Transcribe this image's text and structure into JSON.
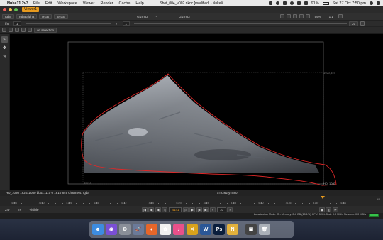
{
  "menubar": {
    "app": "Nuke11.2v3",
    "items": [
      "File",
      "Edit",
      "Workspace",
      "Viewer",
      "Render",
      "Cache",
      "Help"
    ],
    "window_title": "Shot_004_v002.nknc [modified] - NukeX",
    "battery": "91%",
    "clock": "Sat 27 Oct  7:50 pm"
  },
  "viewer_tab": {
    "label": "Viewer1"
  },
  "toolbar1": {
    "channels": "rgba",
    "alpha": "rgba.alpha",
    "display": "RGB",
    "colorspace": "sRGB",
    "input_a": "Gizmo3",
    "input_sep": "-",
    "input_b": "Gizmo3",
    "zoom": "59%",
    "ratio": "1:1"
  },
  "toolbar2": {
    "frame_mode": "f/8",
    "gain_value": "1",
    "gamma_label": "Y",
    "gamma_value": "1",
    "playback_fps": "20"
  },
  "toolbar3": {
    "selection": "on selection"
  },
  "viewer": {
    "format_label_tr": "1920,849",
    "format_label_bl": "110,0",
    "format_label_br": "HD_1080"
  },
  "statusbar": {
    "left": "HD_1080 1920x1080  bbox: 110 0 1810 849  channels: rgba",
    "coords": "x=2262 y=580"
  },
  "timeline": {
    "labels": [
      "4096",
      "4100",
      "4104",
      "4108",
      "4112",
      "4116",
      "4120",
      "4124",
      "4128",
      "4132",
      "4136",
      "4140",
      "4144"
    ],
    "end_frame": "44",
    "current_frame": "4141"
  },
  "transport": {
    "fps": "24*",
    "tf": "TF",
    "visible": "Visible",
    "frame": "4141",
    "step": "10"
  },
  "perf": {
    "text": "Localisation Mode: On  Memory: 2.4 GB (15.1%)  CPU: 5.9%  Disk: 0.0 MB/s  Network: 0.0 MB/s"
  },
  "dock": {
    "apps": [
      {
        "name": "Finder",
        "color": "#3d8ce0",
        "glyph": "☻"
      },
      {
        "name": "Siri",
        "color": "#7a4fd6",
        "glyph": "◉"
      },
      {
        "name": "Preferences",
        "color": "#8a8f99",
        "glyph": "⚙"
      },
      {
        "name": "Launchpad",
        "color": "#6b7a99",
        "glyph": "🚀"
      },
      {
        "name": "Firefox",
        "color": "#e6662a",
        "glyph": "◐"
      },
      {
        "name": "Photos",
        "color": "#f0f0f0",
        "glyph": "✿"
      },
      {
        "name": "iTunes",
        "color": "#e8508a",
        "glyph": "♪"
      },
      {
        "name": "Nuke",
        "color": "#d9a21b",
        "glyph": "✕"
      },
      {
        "name": "Word",
        "color": "#2b5797",
        "glyph": "W"
      },
      {
        "name": "Photoshop",
        "color": "#0a1e3c",
        "glyph": "Ps"
      },
      {
        "name": "NukeX",
        "color": "#e2b13c",
        "glyph": "N"
      },
      {
        "name": "Screenshot",
        "color": "#444",
        "glyph": "▣"
      },
      {
        "name": "Trash",
        "color": "#aab0b8",
        "glyph": "🗑"
      }
    ]
  }
}
